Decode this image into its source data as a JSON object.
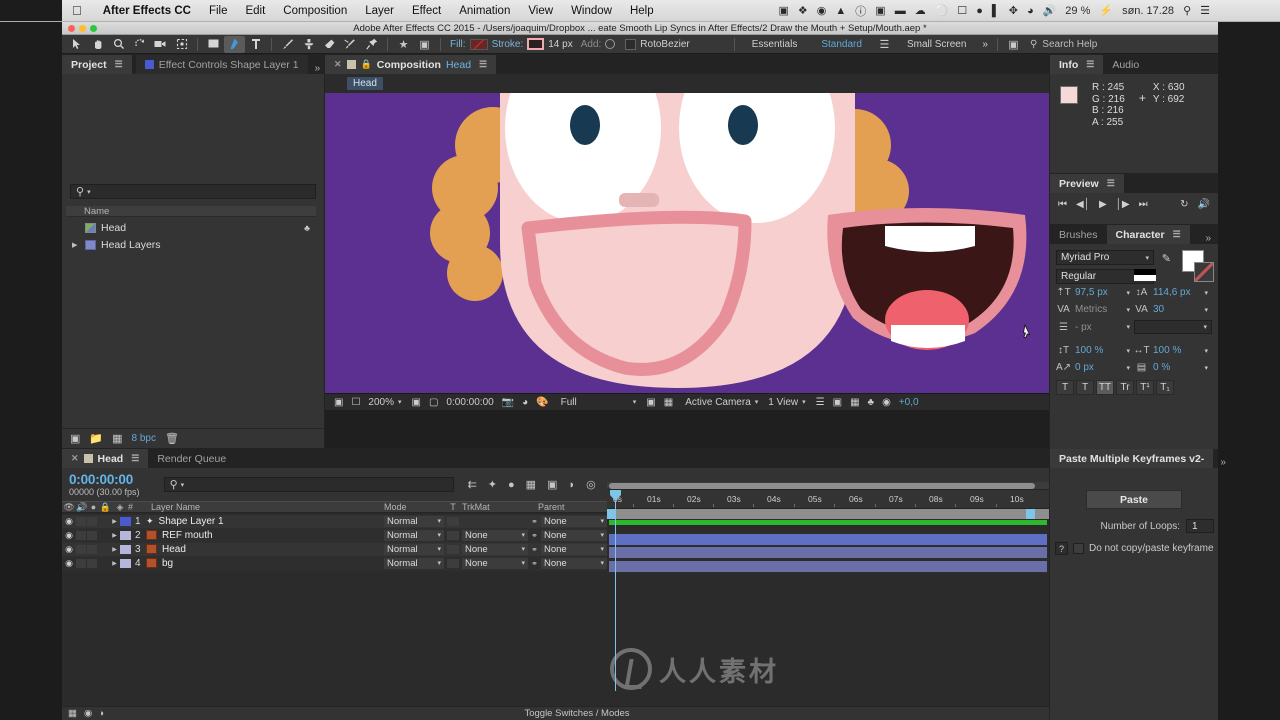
{
  "macos": {
    "apple_icon": "apple-icon",
    "app_name": "After Effects CC",
    "menus": [
      "File",
      "Edit",
      "Composition",
      "Layer",
      "Effect",
      "Animation",
      "View",
      "Window",
      "Help"
    ],
    "status_items": [
      "screen-record-icon",
      "dropbox-icon",
      "vpn-icon",
      "cloud-drive-icon",
      "info-icon",
      "reader-icon",
      "dashlane-icon",
      "cloud-icon",
      "timemachine-icon",
      "display-icon",
      "droplet-icon",
      "battery-health-icon",
      "bluetooth-icon",
      "wifi-icon",
      "volume-icon"
    ],
    "battery": "29 %",
    "battery_bolt": "charging-icon",
    "clock": "søn. 17.28",
    "spotlight": "search-icon",
    "notification_center": "list-icon"
  },
  "window": {
    "title": "Adobe After Effects CC 2015 - /Users/joaquim/Dropbox ... eate Smooth Lip Syncs in After Effects/2 Draw the Mouth + Setup/Mouth.aep *"
  },
  "toolbar": {
    "tools": [
      {
        "name": "selection-tool",
        "glyph": "arrow"
      },
      {
        "name": "hand-tool",
        "glyph": "hand"
      },
      {
        "name": "zoom-tool",
        "glyph": "magnifier"
      },
      {
        "name": "rotation-tool",
        "glyph": "rotate"
      },
      {
        "name": "camera-tool",
        "glyph": "camera"
      },
      {
        "name": "pan-behind-tool",
        "glyph": "anchor"
      },
      {
        "name": "shape-tool",
        "glyph": "rect"
      },
      {
        "name": "pen-tool",
        "glyph": "pen"
      },
      {
        "name": "type-tool",
        "glyph": "text"
      },
      {
        "name": "brush-tool",
        "glyph": "brush"
      },
      {
        "name": "clone-stamp-tool",
        "glyph": "stamp"
      },
      {
        "name": "eraser-tool",
        "glyph": "eraser"
      },
      {
        "name": "roto-brush-tool",
        "glyph": "rotobrush"
      },
      {
        "name": "puppet-pin-tool",
        "glyph": "pin"
      }
    ],
    "fill_label": "Fill:",
    "stroke_label": "Stroke:",
    "stroke_width": "14 px",
    "add_label": "Add:",
    "roto_mode": "RotoBezier",
    "workspaces": [
      "Essentials",
      "Standard",
      "Small Screen"
    ],
    "active_workspace": "Standard",
    "overflow": "»",
    "search_help_placeholder": "Search Help"
  },
  "project": {
    "tabs": [
      {
        "label": "Project",
        "active": true
      },
      {
        "label": "Effect Controls Shape Layer 1",
        "active": false
      }
    ],
    "search_placeholder": "",
    "column_header": "Name",
    "items": [
      {
        "label": "Head",
        "type": "composition",
        "has_arrow": false
      },
      {
        "label": "Head Layers",
        "type": "folder",
        "has_arrow": true
      }
    ],
    "footer": {
      "bpc": "8 bpc"
    }
  },
  "composition": {
    "tab_label": "Composition",
    "tab_name": "Head",
    "chip_label": "Head",
    "footer": {
      "magnification": "200%",
      "time": "0:00:00:00",
      "resolution": "Full",
      "camera": "Active Camera",
      "views": "1 View",
      "offset": "+0,0"
    },
    "stage_colors": {
      "background": "#5b3090",
      "skin": "#f7cfcf",
      "hair": "#e09b4a",
      "eye_white": "#ffffff",
      "pupil": "#173a52",
      "nose": "#e5b4b4",
      "mouth_stroke": "#e8909a",
      "mouth_dark": "#3a1616",
      "tongue": "#f0616e",
      "teeth": "#ffffff"
    }
  },
  "info": {
    "tabs": [
      {
        "label": "Info",
        "active": true
      },
      {
        "label": "Audio",
        "active": false
      }
    ],
    "rgba": [
      "R : 245",
      "G : 216",
      "B : 216",
      "A : 255"
    ],
    "coords": [
      "X : 630",
      "Y : 692"
    ],
    "swatch_color": "#f5d8d8"
  },
  "preview": {
    "title": "Preview",
    "buttons": [
      "first-frame-icon",
      "previous-frame-icon",
      "play-icon",
      "next-frame-icon",
      "last-frame-icon",
      "loop-icon",
      "mute-icon"
    ]
  },
  "character": {
    "tabs": [
      {
        "label": "Brushes",
        "active": false
      },
      {
        "label": "Character",
        "active": true
      }
    ],
    "font_family": "Myriad Pro",
    "font_style": "Regular",
    "font_size": "97,5 px",
    "leading": "114,6 px",
    "kerning": "Metrics",
    "tracking": "30",
    "stroke_width": "- px",
    "vertical_scale": "100 %",
    "horizontal_scale": "100 %",
    "baseline_shift": "0 px",
    "tsume": "0 %",
    "style_buttons": [
      "bold",
      "italic",
      "all-caps",
      "small-caps",
      "superscript",
      "subscript"
    ]
  },
  "paste_keyframes": {
    "title": "Paste Multiple Keyframes v2-",
    "paste_button": "Paste",
    "loops_label": "Number of Loops:",
    "loops_value": "1",
    "help": "?",
    "checkbox_label": "Do not copy/paste keyframe"
  },
  "timeline": {
    "tabs": [
      {
        "label": "Head",
        "active": true
      },
      {
        "label": "Render Queue",
        "active": false
      }
    ],
    "current_time": "0:00:00:00",
    "frames": "00000 (30.00 fps)",
    "search_placeholder": "",
    "columns": [
      "#",
      "Layer Name",
      "Mode",
      "T",
      "TrkMat",
      "Parent"
    ],
    "layers": [
      {
        "num": "1",
        "name": "Shape Layer 1",
        "icon": "shape-icon",
        "color": "#4a5ad0",
        "mode": "Normal",
        "trkmat": "",
        "parent": "None"
      },
      {
        "num": "2",
        "name": "REF mouth",
        "icon": "comp-icon",
        "color": "#b6b6dd",
        "mode": "Normal",
        "trkmat": "None",
        "parent": "None"
      },
      {
        "num": "3",
        "name": "Head",
        "icon": "comp-icon",
        "color": "#b6b6dd",
        "mode": "Normal",
        "trkmat": "None",
        "parent": "None"
      },
      {
        "num": "4",
        "name": "bg",
        "icon": "comp-icon",
        "color": "#b6b6dd",
        "mode": "Normal",
        "trkmat": "None",
        "parent": "None"
      }
    ],
    "ruler_ticks": [
      "0s",
      "01s",
      "02s",
      "03s",
      "04s",
      "05s",
      "06s",
      "07s",
      "08s",
      "09s",
      "10s"
    ],
    "footer_label": "Toggle Switches / Modes"
  },
  "watermark": {
    "text": "人人素材"
  }
}
